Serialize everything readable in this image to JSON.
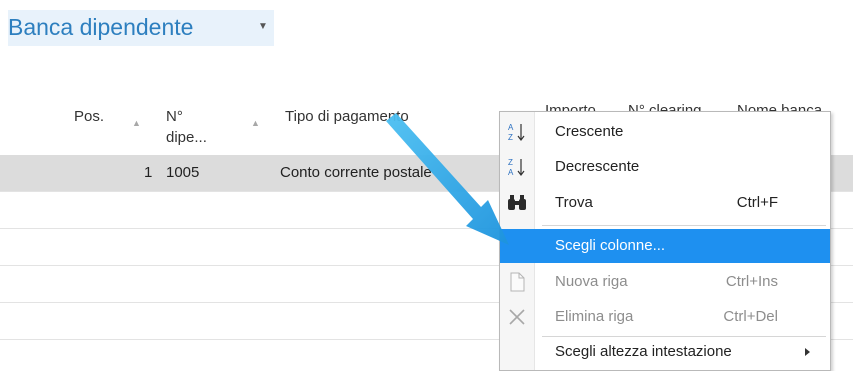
{
  "page": {
    "title": "Banca dipendente"
  },
  "grid": {
    "columns": [
      {
        "label": "Pos."
      },
      {
        "label_line1": "N°",
        "label_line2": "dipe..."
      },
      {
        "label": "Tipo di pagamento"
      },
      {
        "label": "Importo"
      },
      {
        "label": "N° clearing"
      },
      {
        "label": "Nome banca"
      }
    ],
    "rows": [
      {
        "pos": "1",
        "numero": "1005",
        "tipo": "Conto corrente postale"
      }
    ]
  },
  "context_menu": {
    "items": [
      {
        "icon": "sort-ascending-icon",
        "label": "Crescente",
        "shortcut": "",
        "enabled": true
      },
      {
        "icon": "sort-descending-icon",
        "label": "Decrescente",
        "shortcut": "",
        "enabled": true
      },
      {
        "icon": "binoculars-icon",
        "label": "Trova",
        "shortcut": "Ctrl+F",
        "enabled": true
      },
      {
        "icon": "",
        "label": "Scegli colonne...",
        "shortcut": "",
        "enabled": true,
        "highlighted": true
      },
      {
        "icon": "new-document-icon",
        "label": "Nuova riga",
        "shortcut": "Ctrl+Ins",
        "enabled": false
      },
      {
        "icon": "delete-x-icon",
        "label": "Elimina riga",
        "shortcut": "Ctrl+Del",
        "enabled": false
      },
      {
        "icon": "",
        "label": "Scegli altezza intestazione",
        "shortcut": "",
        "enabled": true,
        "has_submenu": true
      }
    ]
  },
  "colors": {
    "title": "#2d7fbf",
    "title_bg": "#e8f2fb",
    "selected_row": "#dcdcdc",
    "menu_highlight": "#1e90f0",
    "arrow": "#2aa6e8"
  }
}
